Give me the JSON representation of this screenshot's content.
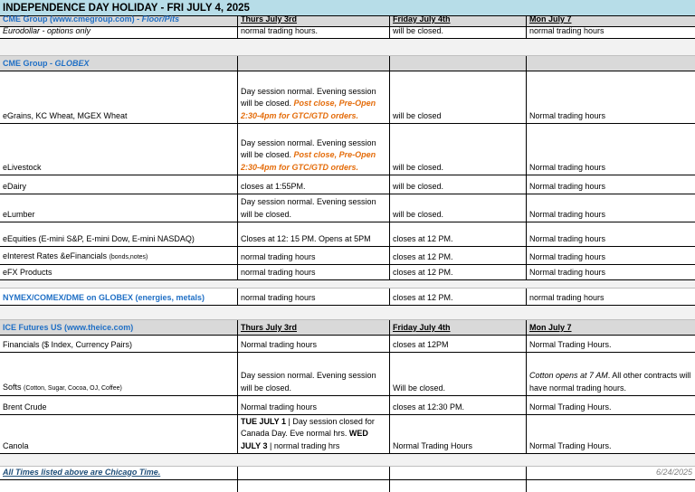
{
  "title": "INDEPENDENCE DAY HOLIDAY  - FRI JULY 4, 2025",
  "cme_floor": {
    "name_a": "CME Group (www.cmegroup.com) - ",
    "name_b": "Floor/Pits",
    "h1": "Thurs July 3rd",
    "h2": "Friday July 4th",
    "h3": "Mon July 7",
    "eurodollar": {
      "label": "Eurodollar - options only",
      "c1": "normal trading hours.",
      "c2": "will be closed.",
      "c3": "normal trading hours"
    }
  },
  "globex": {
    "name_a": "CME Group - ",
    "name_b": "GLOBEX",
    "egrains": {
      "label": "eGrains, KC Wheat, MGEX Wheat",
      "c1a": "Day session normal. Evening session will be closed.",
      "c1b": "Post close, Pre-Open 2:30-4pm for GTC/GTD orders.",
      "c2": "will be closed",
      "c3": "Normal trading hours"
    },
    "elivestock": {
      "label": "eLivestock",
      "c1a": "Day session normal. Evening session will be closed.",
      "c1b": "Post close, Pre-Open 2:30-4pm for GTC/GTD orders.",
      "c2": "will be closed.",
      "c3": "Normal trading hours"
    },
    "edairy": {
      "label": "eDairy",
      "c1": "closes at 1:55PM.",
      "c2": "will be closed.",
      "c3": "Normal trading hours"
    },
    "elumber": {
      "label": "eLumber",
      "c1": "Day session normal. Evening session will be closed.",
      "c2": "will be closed.",
      "c3": "Normal trading hours"
    },
    "eequities": {
      "label": "eEquities (E-mini S&P, E-mini Dow, E-mini NASDAQ)",
      "c1": "Closes at 12: 15 PM. Opens at 5PM",
      "c2": "closes at 12 PM.",
      "c3": "Normal trading hours"
    },
    "einterest": {
      "label": "eInterest Rates &eFinancials ",
      "label_small": "(bonds,notes)",
      "c1": "normal trading hours",
      "c2": "closes at 12 PM.",
      "c3": "Normal trading hours"
    },
    "efx": {
      "label": "eFX Products",
      "c1": "normal trading hours",
      "c2": "closes at 12 PM.",
      "c3": "Normal trading hours"
    }
  },
  "nymex": {
    "label": "NYMEX/COMEX/DME on GLOBEX (energies, metals)",
    "c1": "normal trading hours",
    "c2": "closes at 12 PM.",
    "c3": "normal trading hours"
  },
  "ice": {
    "name": "ICE Futures US (www.theice.com)",
    "h1": "Thurs July 3rd",
    "h2": "Friday July 4th",
    "h3": "Mon July 7",
    "financials": {
      "label": "Financials ($ Index, Currency Pairs)",
      "c1": "Normal trading hours",
      "c2": "closes at 12PM",
      "c3": "Normal Trading Hours."
    },
    "softs": {
      "label": "Softs ",
      "label_small": "(Cotton, Sugar, Cocoa, OJ, Coffee)",
      "c1": "Day session normal. Evening session will be closed.",
      "c2": "Will be closed.",
      "c3a": "Cotton opens at 7 AM",
      "c3b": ". All other contracts will have normal trading hours."
    },
    "brent": {
      "label": "Brent Crude",
      "c1": "Normal trading hours",
      "c2": "closes at 12:30 PM.",
      "c3": "Normal Trading Hours."
    },
    "canola": {
      "label": "Canola",
      "c1_b1": "TUE JULY 1",
      "c1_t1": " | Day session closed for Canada Day. Eve normal hrs. ",
      "c1_b2": "WED JULY 3",
      "c1_t2": " | normal trading hrs",
      "c2": "Normal Trading Hours",
      "c3": "Normal Trading Hours."
    }
  },
  "footer": {
    "note": "All Times listed above are Chicago Time.",
    "date": "6/24/2025"
  }
}
